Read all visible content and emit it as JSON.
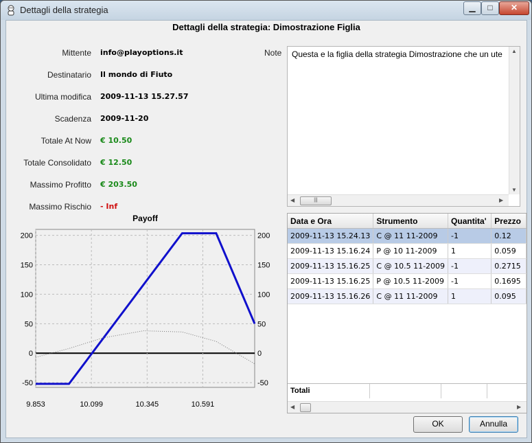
{
  "window": {
    "title": "Dettagli della strategia",
    "heading": "Dettagli della strategia: Dimostrazione Figlia"
  },
  "details": [
    {
      "label": "Mittente",
      "value": "info@playoptions.it",
      "color": "#000000"
    },
    {
      "label": "Destinatario",
      "value": "Il mondo di Fiuto",
      "color": "#000000"
    },
    {
      "label": "Ultima modifica",
      "value": "2009-11-13 15.27.57",
      "color": "#000000"
    },
    {
      "label": "Scadenza",
      "value": "2009-11-20",
      "color": "#000000"
    },
    {
      "label": "Totale At Now",
      "value": "€ 10.50",
      "color": "#1a8a1a"
    },
    {
      "label": "Totale Consolidato",
      "value": "€ 12.50",
      "color": "#1a8a1a"
    },
    {
      "label": "Massimo Profitto",
      "value": "€ 203.50",
      "color": "#1a8a1a"
    },
    {
      "label": "Massimo Rischio",
      "value": "- Inf",
      "color": "#d01010"
    }
  ],
  "note": {
    "label": "Note",
    "text": "Questa e la figlia della strategia Dimostrazione che un ute"
  },
  "table": {
    "columns": [
      "Data e Ora",
      "Strumento",
      "Quantita'",
      "Prezzo"
    ],
    "rows": [
      [
        "2009-11-13 15.24.13",
        "C @ 11 11-2009",
        "-1",
        "0.12"
      ],
      [
        "2009-11-13 15.16.24",
        "P @ 10 11-2009",
        "1",
        "0.059"
      ],
      [
        "2009-11-13 15.16.25",
        "C @ 10.5 11-2009",
        "-1",
        "0.2715"
      ],
      [
        "2009-11-13 15.16.25",
        "P @ 10.5 11-2009",
        "-1",
        "0.1695"
      ],
      [
        "2009-11-13 15.16.26",
        "C @ 11 11-2009",
        "1",
        "0.095"
      ]
    ],
    "totals_label": "Totali"
  },
  "buttons": {
    "ok": "OK",
    "cancel": "Annulla"
  },
  "chart_data": {
    "type": "line",
    "title": "Payoff",
    "xlabel": "",
    "ylabel": "",
    "x_ticks": [
      "9.853",
      "10.099",
      "10.345",
      "10.591"
    ],
    "y_ticks": [
      200,
      150,
      100,
      50,
      0,
      -50
    ],
    "xlim": [
      9.853,
      10.82
    ],
    "ylim": [
      -58,
      210
    ],
    "grid": true,
    "series": [
      {
        "color": "#1010cc",
        "style": "solid-thick",
        "x": [
          9.853,
          9.999,
          10.0,
          10.5,
          10.65,
          10.82
        ],
        "y": [
          -52,
          -52,
          -52,
          203.5,
          203.5,
          50
        ]
      },
      {
        "color": "#777777",
        "style": "dotted",
        "x": [
          9.853,
          10.0,
          10.15,
          10.33,
          10.5,
          10.65,
          10.82
        ],
        "y": [
          -7,
          8,
          26,
          38,
          36,
          20,
          -18
        ]
      }
    ]
  }
}
